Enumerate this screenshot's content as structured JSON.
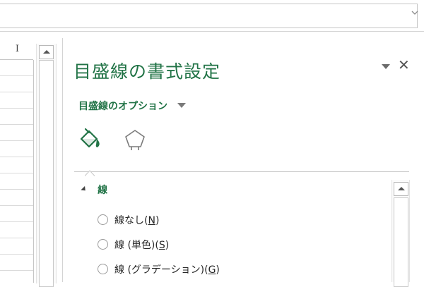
{
  "formula_bar": {
    "dropdown_icon": "chevron-down-icon"
  },
  "sheet": {
    "column_header": "I"
  },
  "pane": {
    "title": "目盛線の書式設定",
    "options_label": "目盛線のオプション",
    "tabs": [
      {
        "name": "fill-line",
        "icon": "paint-bucket-icon"
      },
      {
        "name": "effects",
        "icon": "pentagon-icon"
      }
    ],
    "section": {
      "label": "線"
    },
    "radio_options": [
      {
        "text": "線なし(",
        "key": "N",
        "suffix": ")"
      },
      {
        "text": "線 (単色)(",
        "key": "S",
        "suffix": ")"
      },
      {
        "text": "線 (グラデーション)(",
        "key": "G",
        "suffix": ")"
      }
    ],
    "close_symbol": "✕"
  },
  "colors": {
    "accent": "#217346",
    "text": "#262626",
    "border": "#c6c6c6"
  }
}
